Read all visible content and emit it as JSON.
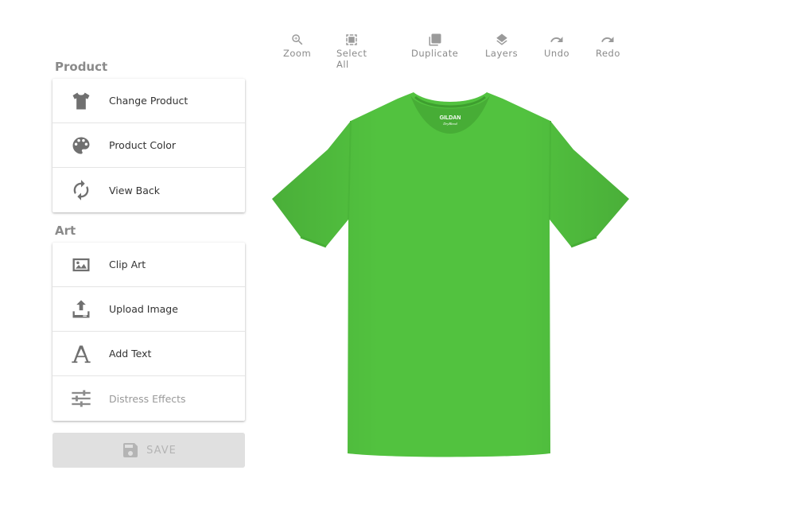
{
  "sections": {
    "product_title": "Product",
    "art_title": "Art"
  },
  "product_items": [
    {
      "label": "Change Product",
      "icon": "tshirt-icon"
    },
    {
      "label": "Product Color",
      "icon": "palette-icon"
    },
    {
      "label": "View Back",
      "icon": "refresh-icon"
    }
  ],
  "art_items": [
    {
      "label": "Clip Art",
      "icon": "image-icon"
    },
    {
      "label": "Upload Image",
      "icon": "upload-icon"
    },
    {
      "label": "Add Text",
      "icon": "text-icon"
    },
    {
      "label": "Distress Effects",
      "icon": "sliders-icon",
      "disabled": true
    }
  ],
  "save": {
    "label": "SAVE",
    "icon": "floppy-disk-icon",
    "disabled": true
  },
  "toolbar": [
    {
      "label": "Zoom",
      "icon": "zoom-in-icon"
    },
    {
      "label": "Select All",
      "icon": "select-all-icon"
    },
    {
      "label": "Duplicate",
      "icon": "duplicate-icon"
    },
    {
      "label": "Layers",
      "icon": "layers-icon"
    },
    {
      "label": "Undo",
      "icon": "undo-icon"
    },
    {
      "label": "Redo",
      "icon": "redo-icon"
    }
  ],
  "product": {
    "color": "#52c23f",
    "brand_label": "GILDAN",
    "brand_sublabel": "DryBlend"
  }
}
